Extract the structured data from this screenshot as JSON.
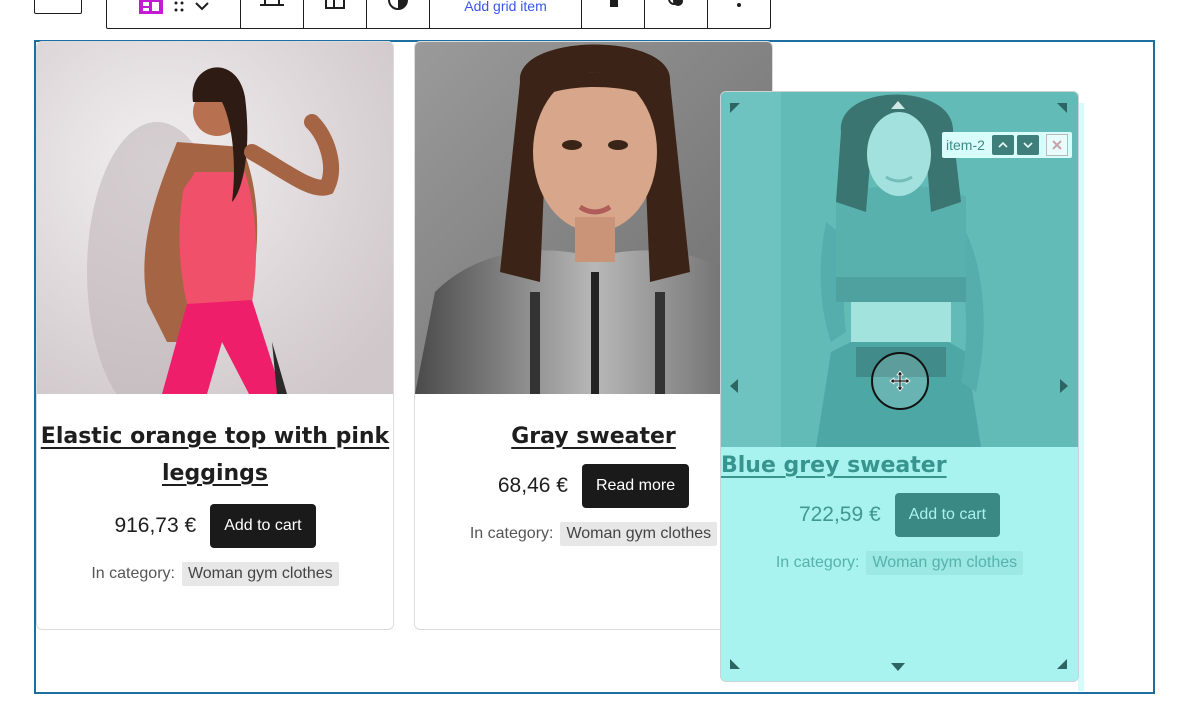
{
  "toolbar": {
    "add_grid_item_label": "Add grid item"
  },
  "products": [
    {
      "title": "Elastic orange top with pink leggings",
      "title_line1": "Elastic orange top with pink",
      "title_line2": "leggings",
      "price": "916,73 €",
      "button": "Add to cart",
      "category_label": "In category:",
      "category": "Woman gym clothes"
    },
    {
      "title": "Gray sweater",
      "price": "68,46 €",
      "button": "Read more",
      "category_label": "In category:",
      "category": "Woman gym clothes"
    },
    {
      "title": "Blue grey sweater",
      "price": "722,59 €",
      "button": "Add to cart",
      "category_label": "In category:",
      "category": "Woman gym clothes"
    }
  ],
  "drag_item": {
    "label": "item-2"
  },
  "colors": {
    "frame": "#1e6fa1",
    "button_dark": "#1a1a1a",
    "drag_overlay": "#c8fbf9",
    "link_blue": "#3858e9"
  },
  "icons": [
    "grid-block-icon",
    "drag-handle-icon",
    "chevron-down-icon",
    "align-icon",
    "layout-icon",
    "contrast-icon",
    "paragraph-icon",
    "link-icon",
    "more-options-icon",
    "move-cursor-icon",
    "chevron-up-icon",
    "close-icon"
  ]
}
